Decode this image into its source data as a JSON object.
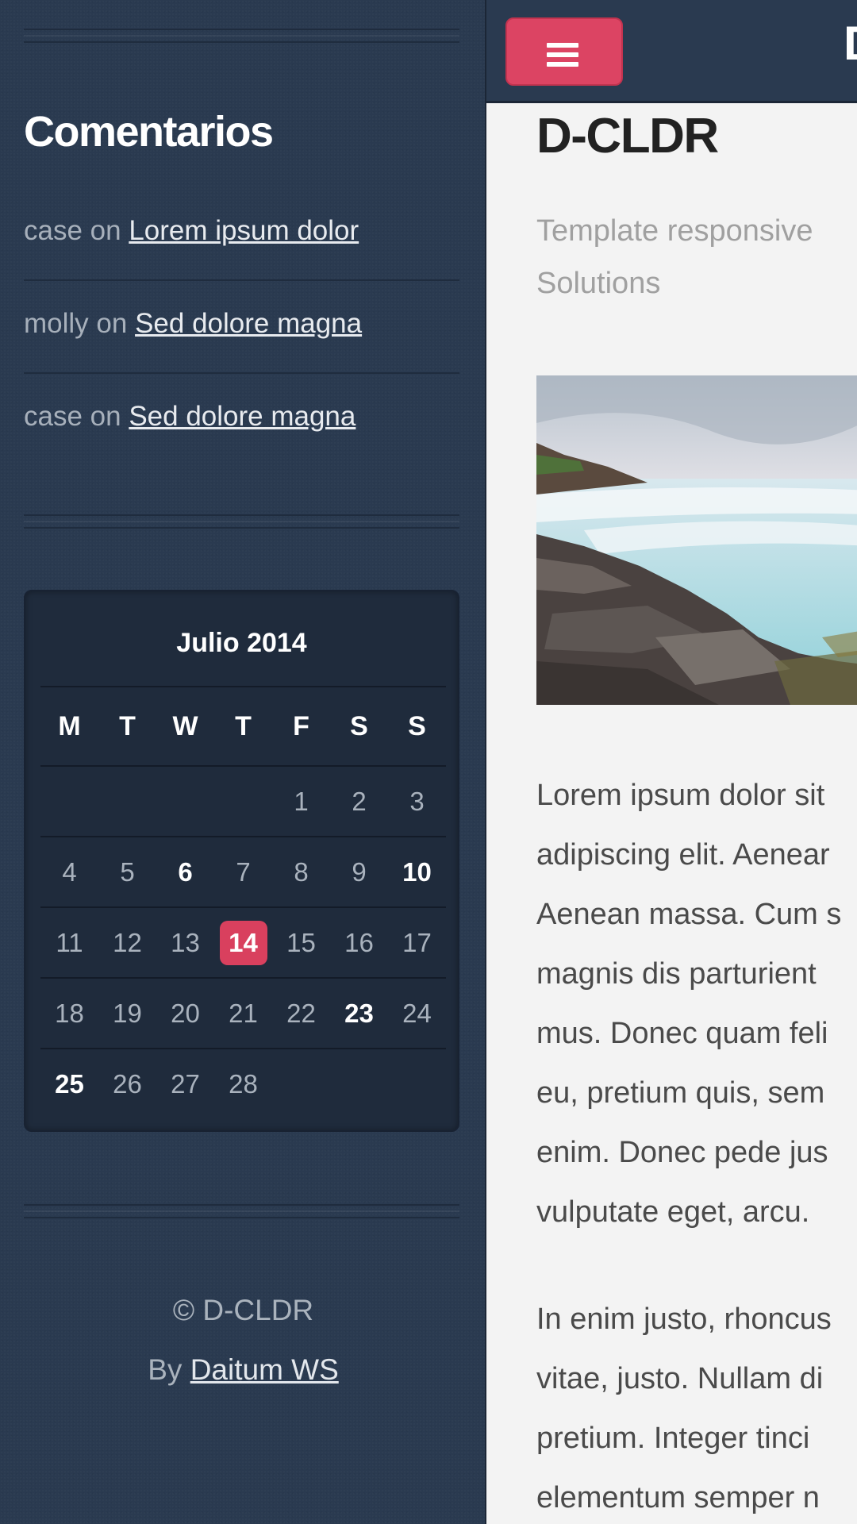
{
  "sidebar": {
    "comments_heading": "Comentarios",
    "comments": [
      {
        "author": "case",
        "sep": " on ",
        "post": "Lorem ipsum dolor"
      },
      {
        "author": "molly",
        "sep": " on ",
        "post": "Sed dolore magna"
      },
      {
        "author": "case",
        "sep": " on ",
        "post": "Sed dolore magna"
      }
    ],
    "calendar": {
      "title": "Julio 2014",
      "weekdays": [
        "M",
        "T",
        "W",
        "T",
        "F",
        "S",
        "S"
      ],
      "weeks": [
        [
          "",
          "",
          "",
          "",
          "1",
          "2",
          "3"
        ],
        [
          "4",
          "5",
          "6",
          "7",
          "8",
          "9",
          "10"
        ],
        [
          "11",
          "12",
          "13",
          "14",
          "15",
          "16",
          "17"
        ],
        [
          "18",
          "19",
          "20",
          "21",
          "22",
          "23",
          "24"
        ],
        [
          "25",
          "26",
          "27",
          "28",
          "",
          "",
          ""
        ]
      ],
      "highlighted_days": [
        "6",
        "10",
        "23",
        "25"
      ],
      "today": "14"
    },
    "footer": {
      "copyright": "© D-CLDR",
      "by_label": "By",
      "author_link": "Daitum WS"
    }
  },
  "topbar": {
    "menu_icon": "hamburger-icon",
    "title": "D"
  },
  "main": {
    "title": "D-CLDR",
    "subtitle": "Template responsive\nSolutions",
    "paragraphs": [
      "Lorem ipsum dolor sit\nadipiscing elit. Aenear\nAenean massa. Cum s\nmagnis dis parturient\nmus. Donec quam feli\neu, pretium quis, sem\nenim. Donec pede jus\nvulputate eget, arcu.",
      "In enim justo, rhoncus\nvitae, justo. Nullam di\npretium. Integer tinci\nelementum semper n"
    ]
  },
  "colors": {
    "sidebar_bg": "#2a3a50",
    "accent": "#dc4463",
    "main_bg": "#f3f3f3"
  }
}
